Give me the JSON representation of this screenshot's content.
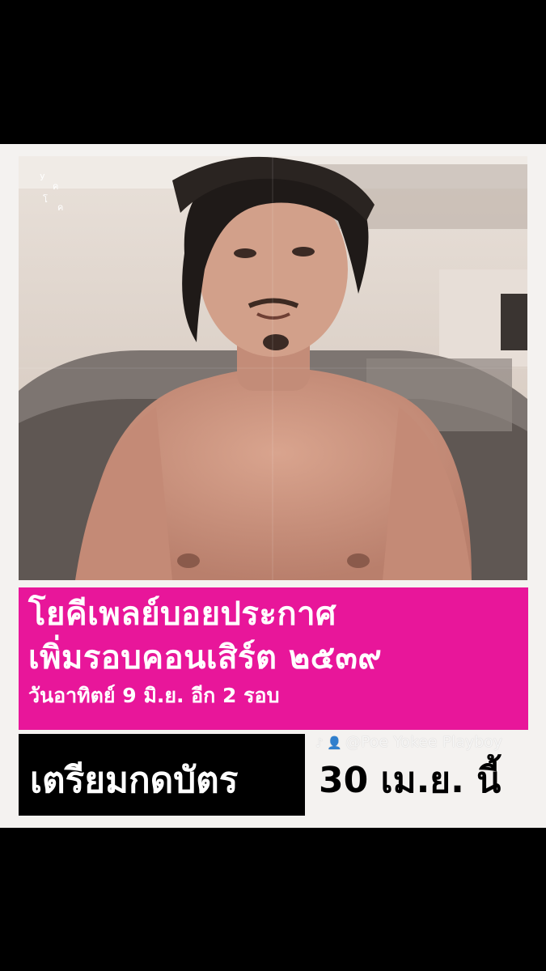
{
  "headline": {
    "line1": "โยคีเพลย์บอยประกาศ",
    "line2": "เพิ่มรอบคอนเสิร์ต ๒๕๓๙",
    "line3": "วันอาทิตย์ 9 มิ.ย. อีก 2 รอบ"
  },
  "cta": {
    "label": "เตรียมกดบัตร",
    "date": "30 เม.ย. นี้"
  },
  "watermark": {
    "text": "@Poe Yokee Playboy",
    "icons": "♪ 👤"
  },
  "logo": {
    "letters": [
      "y",
      "ค",
      "โ",
      "ค"
    ]
  },
  "colors": {
    "background": "#000000",
    "poster": "#f4f2f0",
    "accent": "#e8169a"
  }
}
